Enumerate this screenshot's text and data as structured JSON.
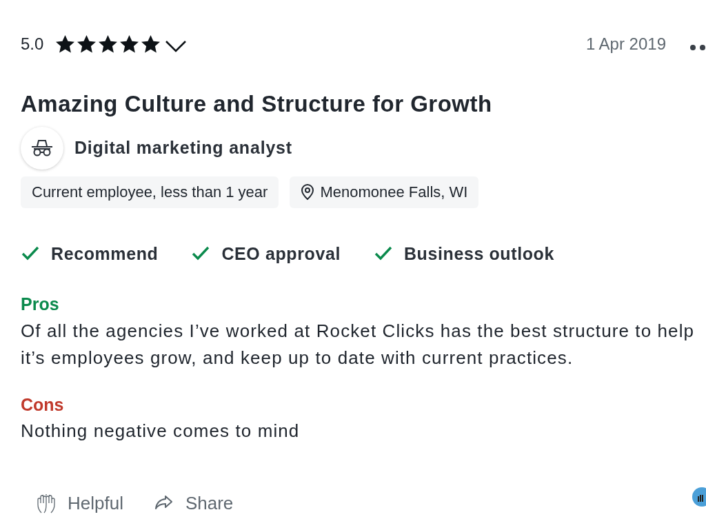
{
  "review": {
    "rating": "5.0",
    "stars": 5,
    "date": "1 Apr 2019",
    "title": "Amazing Culture and Structure for Growth",
    "job_title": "Digital marketing analyst",
    "tags": [
      {
        "kind": "plain",
        "label": "Current employee, less than 1 year"
      },
      {
        "kind": "location",
        "label": "Menomonee Falls, WI"
      }
    ],
    "approvals": [
      {
        "kind": "positive",
        "label": "Recommend"
      },
      {
        "kind": "positive",
        "label": "CEO approval"
      },
      {
        "kind": "positive",
        "label": "Business outlook"
      }
    ],
    "pros": {
      "heading": "Pros",
      "lines": [
        "Of all the agencies I’ve worked at Rocket Clicks has the best structure to help",
        "it’s employees grow, and keep up to date with current practices."
      ]
    },
    "cons": {
      "heading": "Cons",
      "lines": [
        "Nothing negative comes to mind"
      ]
    },
    "actions": [
      {
        "kind": "helpful",
        "label": "Helpful"
      },
      {
        "kind": "share",
        "label": "Share"
      }
    ]
  }
}
